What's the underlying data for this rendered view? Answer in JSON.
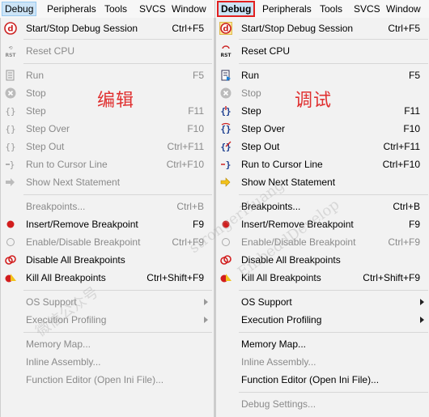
{
  "left": {
    "menubar": [
      "Debug",
      "Peripherals",
      "Tools",
      "SVCS",
      "Window"
    ],
    "annotation": "编辑",
    "items": [
      {
        "label": "Start/Stop Debug Session",
        "shortcut": "Ctrl+F5",
        "icon": "debug-session-icon",
        "disabled": false
      },
      {
        "label": "Reset CPU",
        "shortcut": "",
        "icon": "reset-cpu-icon",
        "disabled": true
      },
      {
        "label": "Run",
        "shortcut": "F5",
        "icon": "run-icon",
        "disabled": true
      },
      {
        "label": "Stop",
        "shortcut": "",
        "icon": "stop-icon",
        "disabled": true
      },
      {
        "label": "Step",
        "shortcut": "F11",
        "icon": "step-icon",
        "disabled": true
      },
      {
        "label": "Step Over",
        "shortcut": "F10",
        "icon": "step-over-icon",
        "disabled": true
      },
      {
        "label": "Step Out",
        "shortcut": "Ctrl+F11",
        "icon": "step-out-icon",
        "disabled": true
      },
      {
        "label": "Run to Cursor Line",
        "shortcut": "Ctrl+F10",
        "icon": "run-to-cursor-icon",
        "disabled": true
      },
      {
        "label": "Show Next Statement",
        "shortcut": "",
        "icon": "show-next-statement-icon",
        "disabled": true
      },
      {
        "label": "Breakpoints...",
        "shortcut": "Ctrl+B",
        "icon": "",
        "disabled": true
      },
      {
        "label": "Insert/Remove Breakpoint",
        "shortcut": "F9",
        "icon": "breakpoint-icon",
        "disabled": false
      },
      {
        "label": "Enable/Disable Breakpoint",
        "shortcut": "Ctrl+F9",
        "icon": "enable-breakpoint-icon",
        "disabled": true
      },
      {
        "label": "Disable All Breakpoints",
        "shortcut": "",
        "icon": "disable-all-breakpoints-icon",
        "disabled": false
      },
      {
        "label": "Kill All Breakpoints",
        "shortcut": "Ctrl+Shift+F9",
        "icon": "kill-breakpoints-icon",
        "disabled": false
      },
      {
        "label": "OS Support",
        "shortcut": "",
        "icon": "",
        "disabled": true,
        "submenu": true
      },
      {
        "label": "Execution Profiling",
        "shortcut": "",
        "icon": "",
        "disabled": true,
        "submenu": true
      },
      {
        "label": "Memory Map...",
        "shortcut": "",
        "icon": "",
        "disabled": true
      },
      {
        "label": "Inline Assembly...",
        "shortcut": "",
        "icon": "",
        "disabled": true
      },
      {
        "label": "Function Editor (Open Ini File)...",
        "shortcut": "",
        "icon": "",
        "disabled": true
      }
    ]
  },
  "right": {
    "menubar": [
      "Debug",
      "Peripherals",
      "Tools",
      "SVCS",
      "Window"
    ],
    "annotation": "调试",
    "items": [
      {
        "label": "Start/Stop Debug Session",
        "shortcut": "Ctrl+F5",
        "icon": "debug-session-icon",
        "disabled": false
      },
      {
        "label": "Reset CPU",
        "shortcut": "",
        "icon": "reset-cpu-icon",
        "disabled": false
      },
      {
        "label": "Run",
        "shortcut": "F5",
        "icon": "run-icon",
        "disabled": false
      },
      {
        "label": "Stop",
        "shortcut": "",
        "icon": "stop-icon",
        "disabled": true
      },
      {
        "label": "Step",
        "shortcut": "F11",
        "icon": "step-icon",
        "disabled": false
      },
      {
        "label": "Step Over",
        "shortcut": "F10",
        "icon": "step-over-icon",
        "disabled": false
      },
      {
        "label": "Step Out",
        "shortcut": "Ctrl+F11",
        "icon": "step-out-icon",
        "disabled": false
      },
      {
        "label": "Run to Cursor Line",
        "shortcut": "Ctrl+F10",
        "icon": "run-to-cursor-icon",
        "disabled": false
      },
      {
        "label": "Show Next Statement",
        "shortcut": "",
        "icon": "show-next-statement-icon",
        "disabled": false
      },
      {
        "label": "Breakpoints...",
        "shortcut": "Ctrl+B",
        "icon": "",
        "disabled": false
      },
      {
        "label": "Insert/Remove Breakpoint",
        "shortcut": "F9",
        "icon": "breakpoint-icon",
        "disabled": false
      },
      {
        "label": "Enable/Disable Breakpoint",
        "shortcut": "Ctrl+F9",
        "icon": "enable-breakpoint-icon",
        "disabled": true
      },
      {
        "label": "Disable All Breakpoints",
        "shortcut": "",
        "icon": "disable-all-breakpoints-icon",
        "disabled": false
      },
      {
        "label": "Kill All Breakpoints",
        "shortcut": "Ctrl+Shift+F9",
        "icon": "kill-breakpoints-icon",
        "disabled": false
      },
      {
        "label": "OS Support",
        "shortcut": "",
        "icon": "",
        "disabled": false,
        "submenu": true
      },
      {
        "label": "Execution Profiling",
        "shortcut": "",
        "icon": "",
        "disabled": false,
        "submenu": true
      },
      {
        "label": "Memory Map...",
        "shortcut": "",
        "icon": "",
        "disabled": false
      },
      {
        "label": "Inline Assembly...",
        "shortcut": "",
        "icon": "",
        "disabled": true
      },
      {
        "label": "Function Editor (Open Ini File)...",
        "shortcut": "",
        "icon": "",
        "disabled": false
      },
      {
        "label": "Debug Settings...",
        "shortcut": "",
        "icon": "",
        "disabled": true
      }
    ]
  },
  "watermark": [
    "微信公众号",
    "strongerHuang",
    "EmbeddDevelop"
  ],
  "colors": {
    "accent": "#cce4f7",
    "highlight_border": "#e22020",
    "annotation": "#e03030",
    "disabled_text": "#8a8a8a"
  }
}
